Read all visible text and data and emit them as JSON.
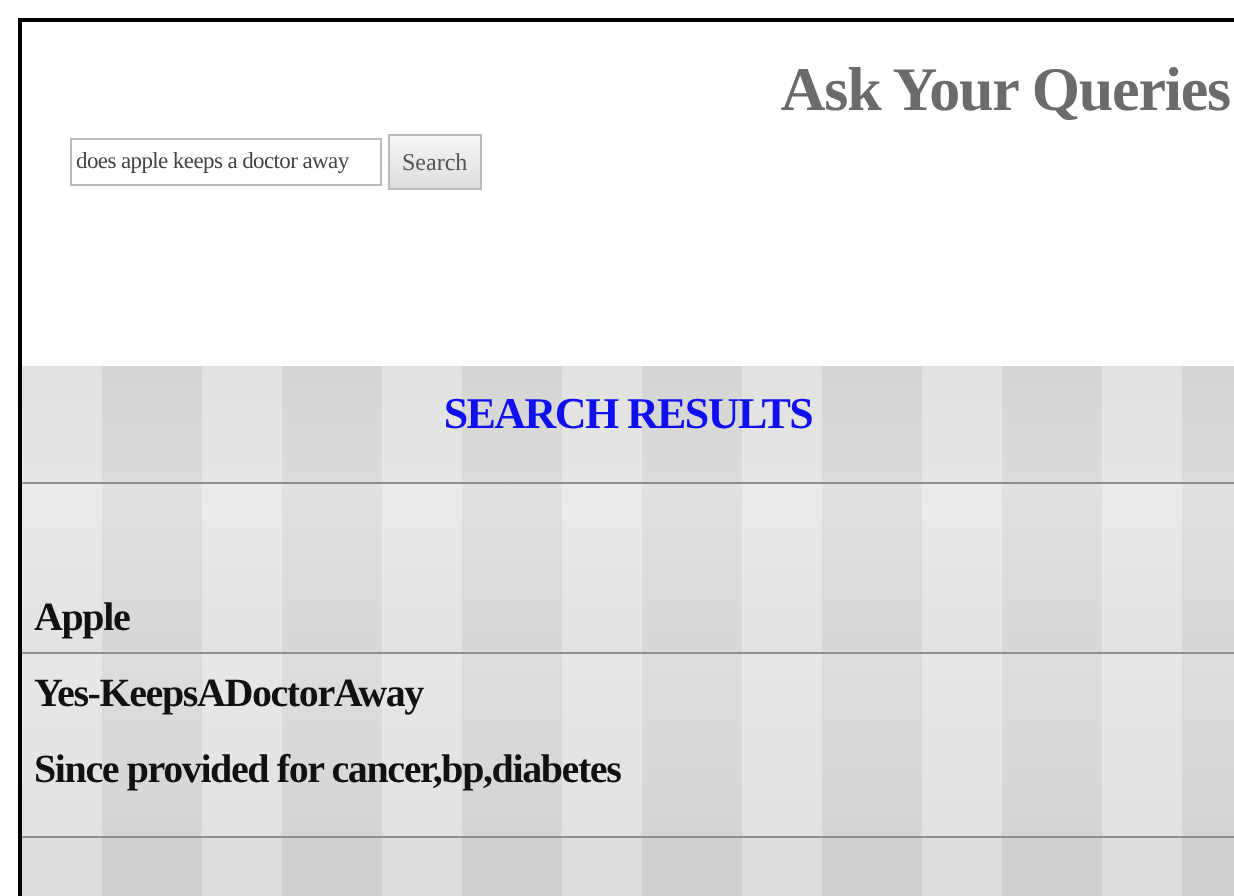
{
  "title": "Ask Your Queries",
  "search": {
    "value": "does apple keeps a doctor away",
    "button": "Search"
  },
  "results": {
    "heading": "SEARCH RESULTS",
    "lines": [
      "Apple",
      "Yes-KeepsADoctorAway",
      "Since provided for cancer,bp,diabetes"
    ]
  }
}
